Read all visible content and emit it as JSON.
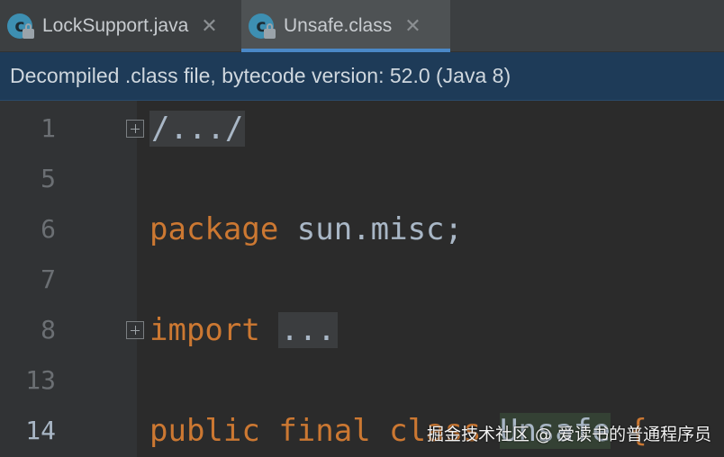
{
  "tabs": [
    {
      "label": "LockSupport.java",
      "icon": "java-class-locked-icon",
      "active": false
    },
    {
      "label": "Unsafe.class",
      "icon": "java-class-locked-icon",
      "active": true
    }
  ],
  "tab_close_glyph": "✕",
  "banner": {
    "text": "Decompiled .class file, bytecode version: 52.0 (Java 8)"
  },
  "editor": {
    "lines": [
      {
        "number": "1"
      },
      {
        "number": "5"
      },
      {
        "number": "6"
      },
      {
        "number": "7"
      },
      {
        "number": "8"
      },
      {
        "number": "13"
      },
      {
        "number": "14"
      }
    ],
    "code": {
      "line1_folded": "/.../",
      "line6_keyword": "package",
      "line6_rest": " sun.misc;",
      "line8_keyword": "import",
      "line8_folded": "...",
      "line14_kw1": "public",
      "line14_kw2": "final",
      "line14_kw3": "class",
      "line14_name": "Unsafe",
      "line14_brace": "{"
    }
  },
  "watermark": "掘金技术社区 @ 爱读书的普通程序员",
  "colors": {
    "keyword": "#cc7832",
    "text": "#a9b7c6",
    "banner_bg": "#1e3b58",
    "active_tab_underline": "#4a88c7"
  }
}
